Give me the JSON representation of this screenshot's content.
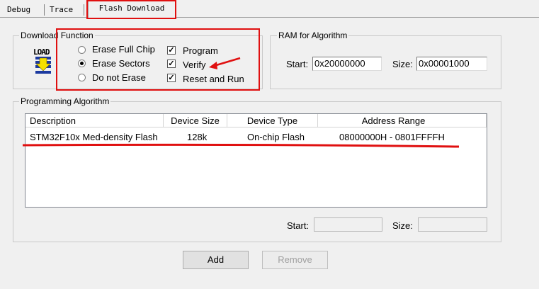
{
  "tabs": [
    "Debug",
    "Trace",
    "Flash Download"
  ],
  "download_function": {
    "legend": "Download Function",
    "icon_text": "LOAD",
    "erase_options": [
      "Erase Full Chip",
      "Erase Sectors",
      "Do not Erase"
    ],
    "selected_erase": "Erase Sectors",
    "checks": [
      {
        "label": "Program",
        "checked": true
      },
      {
        "label": "Verify",
        "checked": true
      },
      {
        "label": "Reset and Run",
        "checked": true
      }
    ]
  },
  "ram": {
    "legend": "RAM for Algorithm",
    "start_label": "Start:",
    "start_value": "0x20000000",
    "size_label": "Size:",
    "size_value": "0x00001000"
  },
  "algorithm": {
    "legend": "Programming Algorithm",
    "columns": [
      "Description",
      "Device Size",
      "Device Type",
      "Address Range"
    ],
    "rows": [
      [
        "STM32F10x Med-density Flash",
        "128k",
        "On-chip Flash",
        "08000000H - 0801FFFFH"
      ]
    ],
    "start_label": "Start:",
    "start_value": "",
    "size_label": "Size:",
    "size_value": ""
  },
  "buttons": {
    "add": "Add",
    "remove": "Remove"
  },
  "colors": {
    "annotation": "#e01010",
    "background": "#f0f0f0"
  }
}
